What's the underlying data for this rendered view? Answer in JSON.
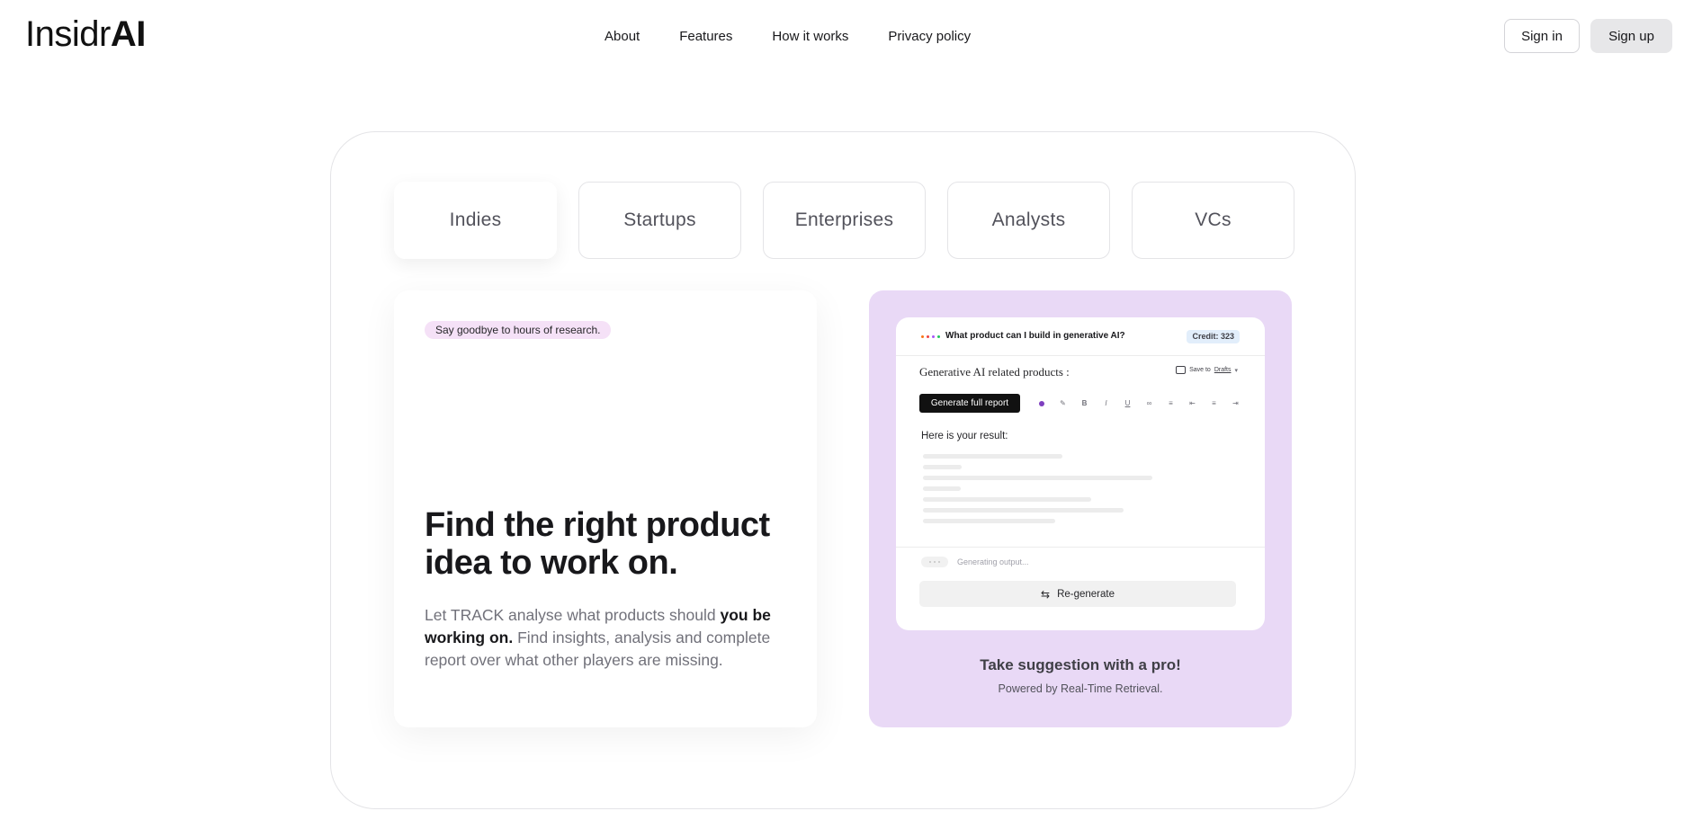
{
  "header": {
    "logo_light": "Insidr",
    "logo_bold": "AI",
    "nav": [
      "About",
      "Features",
      "How it works",
      "Privacy policy"
    ],
    "sign_in": "Sign in",
    "sign_up": "Sign up"
  },
  "tabs": [
    "Indies",
    "Startups",
    "Enterprises",
    "Analysts",
    "VCs"
  ],
  "active_tab": "Indies",
  "feature": {
    "pill": "Say goodbye to hours of research.",
    "headline": "Find the right product idea to work on.",
    "desc_part1": "Let TRACK analyse what products should ",
    "desc_strong": "you be working on.",
    "desc_part2": " Find insights, analysis and complete report over what other players are missing."
  },
  "preview": {
    "query": "What product can I build in generative AI?",
    "credit": "Credit: 323",
    "doc_title": "Generative AI related products :",
    "save_prefix": "Save to",
    "save_target": "Drafts",
    "generate_button": "Generate full report",
    "toolbar": [
      "pen-icon",
      "bold-icon",
      "italic-icon",
      "underline-icon",
      "link-icon",
      "list-icon",
      "align-left-icon",
      "align-center-icon",
      "align-right-icon"
    ],
    "result_label": "Here is your result:",
    "generating": "Generating output...",
    "regenerate": "Re-generate",
    "title": "Take suggestion with a pro!",
    "subtitle": "Powered by Real-Time Retrieval."
  },
  "colors": {
    "accent_purple_bg": "#e9d9f6",
    "pill_bg": "#f5e1f7",
    "dot_colors": [
      "#f97316",
      "#ef4444",
      "#a855f7",
      "#22c55e"
    ]
  }
}
